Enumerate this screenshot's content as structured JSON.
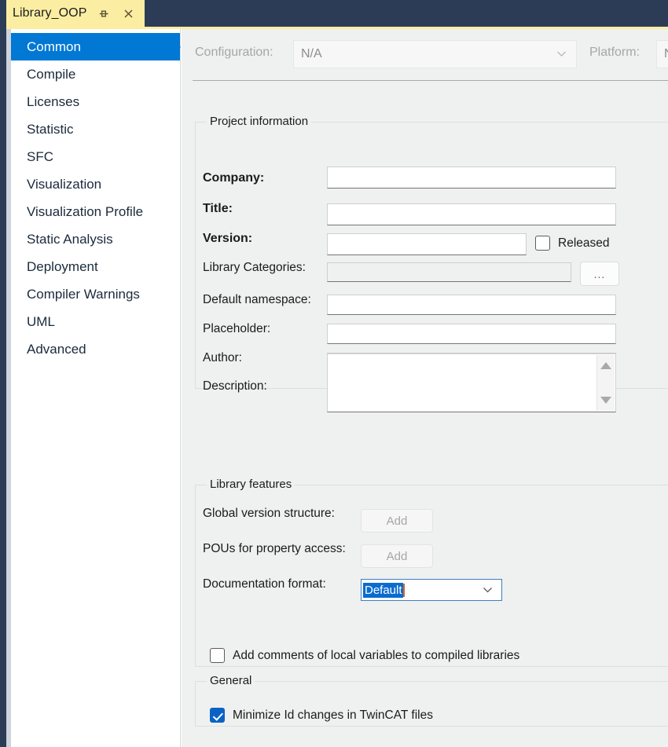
{
  "window": {
    "tab_title": "Library_OOP",
    "pin_icon": "pin-icon",
    "close_icon": "close-icon"
  },
  "sidebar": {
    "items": [
      {
        "label": "Common",
        "selected": true
      },
      {
        "label": "Compile",
        "selected": false
      },
      {
        "label": "Licenses",
        "selected": false
      },
      {
        "label": "Statistic",
        "selected": false
      },
      {
        "label": "SFC",
        "selected": false
      },
      {
        "label": "Visualization",
        "selected": false
      },
      {
        "label": "Visualization Profile",
        "selected": false
      },
      {
        "label": "Static Analysis",
        "selected": false
      },
      {
        "label": "Deployment",
        "selected": false
      },
      {
        "label": "Compiler Warnings",
        "selected": false
      },
      {
        "label": "UML",
        "selected": false
      },
      {
        "label": "Advanced",
        "selected": false
      }
    ]
  },
  "config_bar": {
    "configuration_label": "Configuration:",
    "configuration_value": "N/A",
    "platform_label": "Platform:",
    "platform_value": "N"
  },
  "project_information": {
    "legend": "Project information",
    "company_label": "Company:",
    "company_value": "",
    "title_label": "Title:",
    "title_value": "",
    "version_label": "Version:",
    "version_value": "",
    "released_label": "Released",
    "released_checked": false,
    "library_categories_label": "Library Categories:",
    "library_categories_value": "",
    "browse_button_label": "...",
    "default_namespace_label": "Default namespace:",
    "default_namespace_value": "",
    "placeholder_label": "Placeholder:",
    "placeholder_value": "",
    "author_label": "Author:",
    "author_value": "",
    "description_label": "Description:",
    "description_value": ""
  },
  "library_features": {
    "legend": "Library features",
    "global_version_structure_label": "Global version structure:",
    "global_version_structure_button": "Add",
    "pous_property_access_label": "POUs for property access:",
    "pous_property_access_button": "Add",
    "documentation_format_label": "Documentation format:",
    "documentation_format_value": "Default",
    "add_comments_label": "Add comments of local variables to compiled libraries",
    "add_comments_checked": false
  },
  "general": {
    "legend": "General",
    "minimize_id_label": "Minimize Id changes in TwinCAT files",
    "minimize_id_checked": true
  },
  "colors": {
    "titlebar": "#2d3c56",
    "tab": "#fbeea3",
    "accent": "#0078d4",
    "content_bg": "#eff0f0",
    "checkbox_checked": "#0a63c4",
    "combo_focus_border": "#3f7fbf"
  }
}
